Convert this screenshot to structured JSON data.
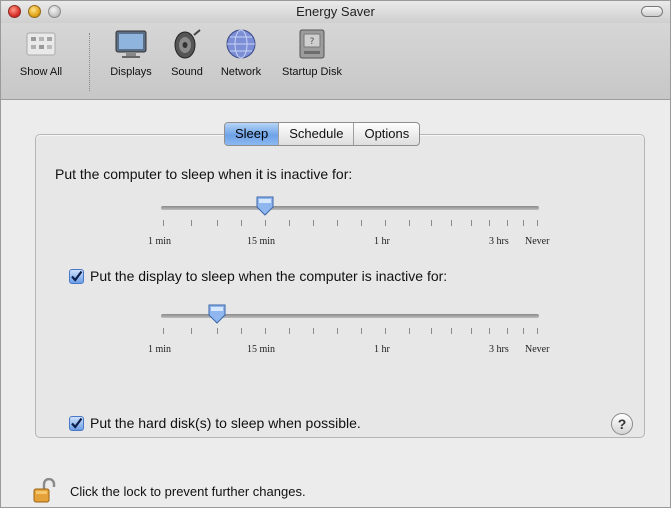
{
  "window": {
    "title": "Energy Saver"
  },
  "toolbar": {
    "items": [
      {
        "label": "Show All",
        "icon": "grid-icon"
      },
      {
        "label": "Displays",
        "icon": "monitor-icon"
      },
      {
        "label": "Sound",
        "icon": "speaker-icon"
      },
      {
        "label": "Network",
        "icon": "globe-icon"
      },
      {
        "label": "Startup Disk",
        "icon": "hard-disk-icon"
      }
    ]
  },
  "tabs": [
    {
      "label": "Sleep",
      "active": true
    },
    {
      "label": "Schedule",
      "active": false
    },
    {
      "label": "Options",
      "active": false
    }
  ],
  "computer_sleep": {
    "label": "Put the computer to sleep when it is inactive for:",
    "tick_labels": [
      "1 min",
      "15 min",
      "1 hr",
      "3 hrs",
      "Never"
    ],
    "value": "15 min"
  },
  "display_sleep": {
    "label": "Put the display to sleep when the computer is inactive for:",
    "checked": true,
    "tick_labels": [
      "1 min",
      "15 min",
      "1 hr",
      "3 hrs",
      "Never"
    ],
    "value": "5 min"
  },
  "disk_sleep": {
    "label": "Put the hard disk(s) to sleep when possible.",
    "checked": true
  },
  "help": {
    "label": "?"
  },
  "lock": {
    "text": "Click the lock to prevent further changes.",
    "icon": "unlocked-padlock-icon"
  },
  "colors": {
    "accent": "#6ea3e8",
    "window_bg": "#ececec"
  }
}
